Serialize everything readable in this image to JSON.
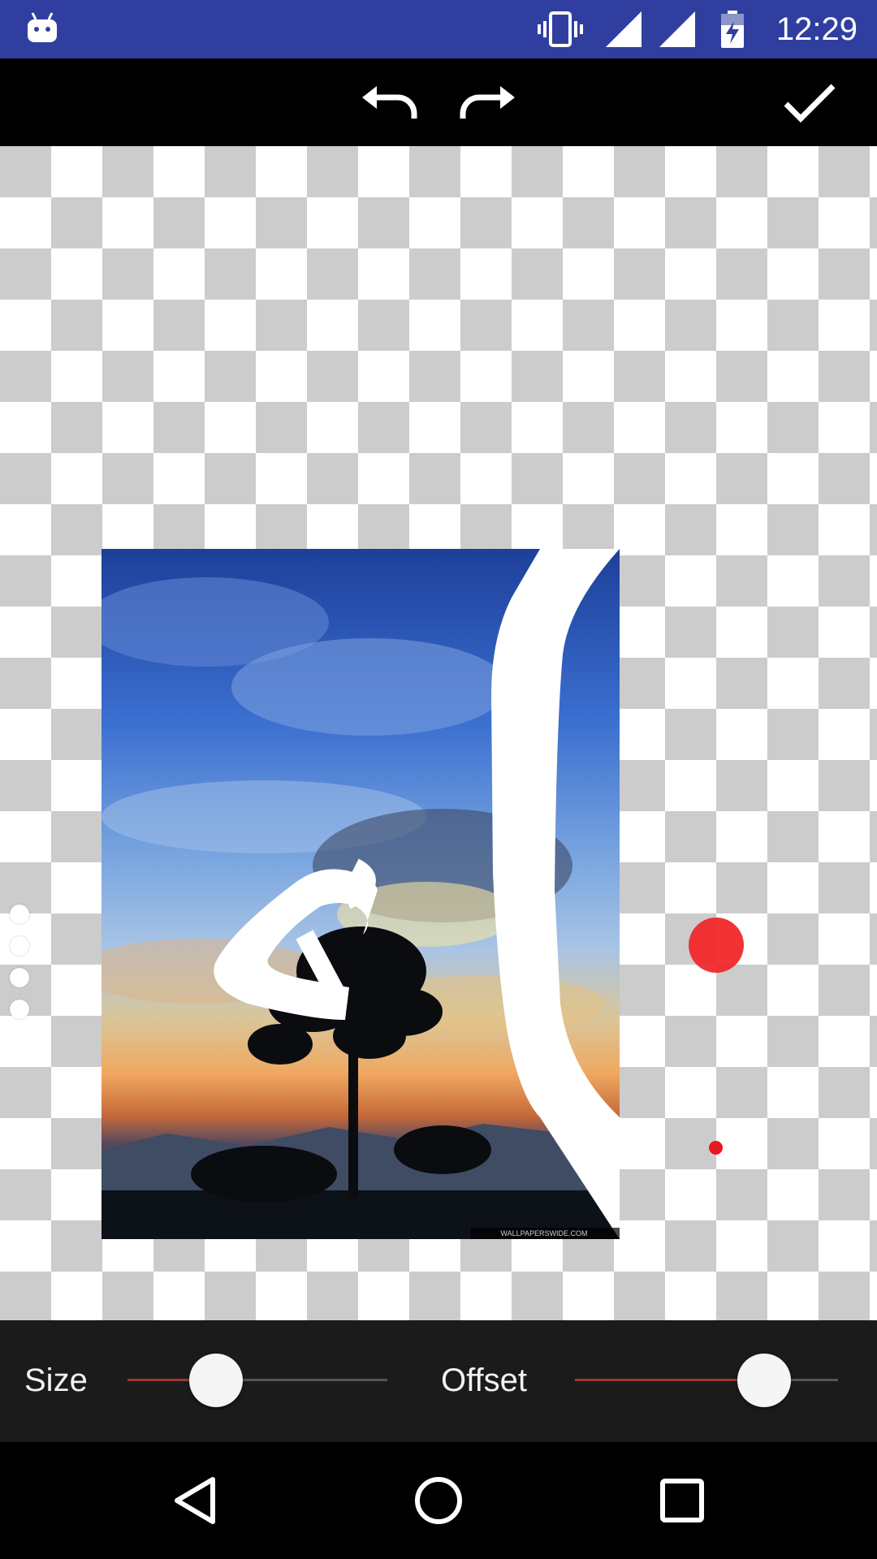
{
  "status_bar": {
    "time": "12:29",
    "icons": [
      "android-icon",
      "vibrate-icon",
      "signal-icon",
      "signal-icon",
      "battery-charging-icon"
    ]
  },
  "toolbar": {
    "buttons": [
      "undo-icon",
      "redo-icon",
      "check-icon"
    ]
  },
  "canvas": {
    "background": "transparency-checkerboard",
    "brush_color": "#f0282a",
    "photo_watermark": "WALLPAPERSWIDE.COM"
  },
  "controls": {
    "size_label": "Size",
    "size_value": 0.34,
    "offset_label": "Offset",
    "offset_value": 0.72,
    "accent": "#9b3a2f"
  },
  "nav": {
    "buttons": [
      "back-icon",
      "home-icon",
      "recents-icon"
    ]
  }
}
